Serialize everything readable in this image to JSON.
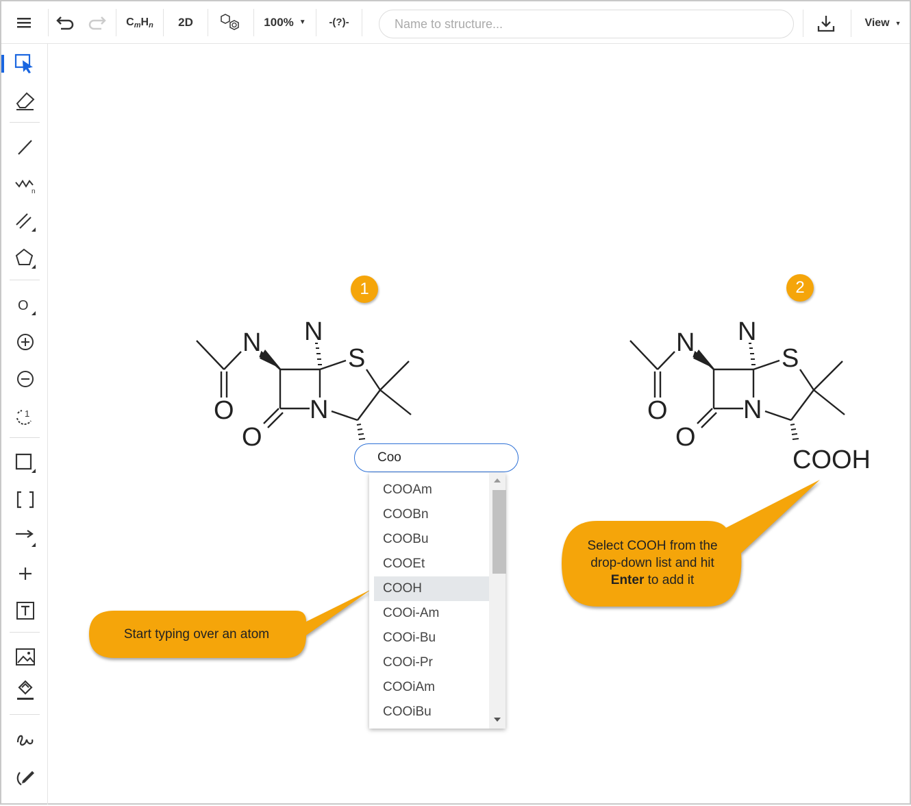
{
  "toolbar": {
    "menu_icon": "hamburger-icon",
    "formula_label_c": "C",
    "formula_label_m": "m",
    "formula_label_h": "H",
    "formula_label_n": "n",
    "mode_2d": "2D",
    "zoom": "100%",
    "search_placeholder": "Name to structure...",
    "view_label": "View"
  },
  "sidebar": {
    "tools": [
      "select",
      "eraser",
      "single-bond",
      "chain",
      "multi-bond",
      "ring",
      "atom",
      "charge-plus",
      "charge-minus",
      "atom-mapping",
      "shape",
      "bracket",
      "arrow",
      "plus",
      "text",
      "image",
      "rgroup",
      "freehand",
      "sketch-pen"
    ],
    "active": "select",
    "accent": "#1a66e0"
  },
  "canvas": {
    "badges": [
      "1",
      "2"
    ],
    "molecule": {
      "atoms": {
        "n_amide": "N",
        "n_top": "N",
        "s": "S",
        "n_ring": "N",
        "o_amide": "O",
        "o_lactam": "O"
      }
    },
    "product_group": "COOH",
    "atom_input": {
      "value": "Coo"
    },
    "dropdown": {
      "items": [
        "COOAm",
        "COOBn",
        "COOBu",
        "COOEt",
        "COOH",
        "COOi-Am",
        "COOi-Bu",
        "COOi-Pr",
        "COOiAm",
        "COOiBu"
      ],
      "selected": "COOH"
    },
    "callout1": "Start typing over an atom",
    "callout2_line1": "Select COOH from the",
    "callout2_line2": "drop-down list and hit",
    "callout2_bold": "Enter",
    "callout2_rest": " to add it",
    "callout_color": "#f5a50a"
  }
}
